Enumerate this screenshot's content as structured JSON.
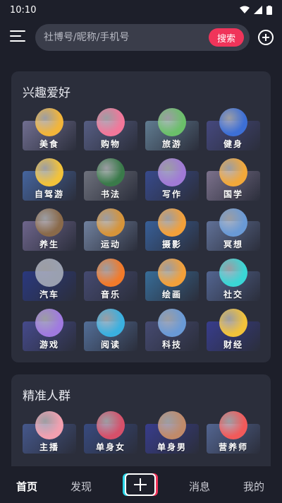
{
  "status": {
    "time": "10:10"
  },
  "search": {
    "placeholder": "社博号/昵称/手机号",
    "button": "搜索"
  },
  "hobbies": {
    "title": "兴趣爱好",
    "items": [
      {
        "label": "美食",
        "icon": "food-icon",
        "color": "#f2b53a",
        "bg": "#7d7aa0"
      },
      {
        "label": "购物",
        "icon": "shopping-bag-icon",
        "color": "#f2779a",
        "bg": "#5e6690"
      },
      {
        "label": "旅游",
        "icon": "travel-icon",
        "color": "#6bbf6a",
        "bg": "#6a8aa0"
      },
      {
        "label": "健身",
        "icon": "fitness-icon",
        "color": "#3d6fd6",
        "bg": "#4a4d8a"
      },
      {
        "label": "自驾游",
        "icon": "car-trip-icon",
        "color": "#f2c23a",
        "bg": "#4a6fb0"
      },
      {
        "label": "书法",
        "icon": "calligraphy-icon",
        "color": "#3a7a4a",
        "bg": "#7a7d88"
      },
      {
        "label": "写作",
        "icon": "writing-icon",
        "color": "#a07ad6",
        "bg": "#3a4f9a"
      },
      {
        "label": "国学",
        "icon": "classics-icon",
        "color": "#f2a83a",
        "bg": "#8a7d9a"
      },
      {
        "label": "养生",
        "icon": "health-icon",
        "color": "#8a6a4a",
        "bg": "#7a6f9a"
      },
      {
        "label": "运动",
        "icon": "sports-icon",
        "color": "#d6943a",
        "bg": "#7d90b0"
      },
      {
        "label": "摄影",
        "icon": "camera-icon",
        "color": "#f2a03a",
        "bg": "#3a68a8"
      },
      {
        "label": "冥想",
        "icon": "meditation-icon",
        "color": "#6a9ad6",
        "bg": "#6a7da8"
      },
      {
        "label": "汽车",
        "icon": "car-icon",
        "color": "#9aa0b0",
        "bg": "#2a3a8a"
      },
      {
        "label": "音乐",
        "icon": "music-icon",
        "color": "#f27a2a",
        "bg": "#4a4f7a"
      },
      {
        "label": "绘画",
        "icon": "palette-icon",
        "color": "#f2a03a",
        "bg": "#3a78a8"
      },
      {
        "label": "社交",
        "icon": "social-icon",
        "color": "#3ad6d6",
        "bg": "#5a6fa0"
      },
      {
        "label": "游戏",
        "icon": "gamepad-icon",
        "color": "#a07ae0",
        "bg": "#4a4f9a"
      },
      {
        "label": "阅读",
        "icon": "reading-icon",
        "color": "#3ab0e0",
        "bg": "#5a7aa8"
      },
      {
        "label": "科技",
        "icon": "tech-icon",
        "color": "#6a9ad6",
        "bg": "#4a4f7a"
      },
      {
        "label": "财经",
        "icon": "finance-icon",
        "color": "#f2c23a",
        "bg": "#3a3f9a"
      }
    ]
  },
  "crowd": {
    "title": "精准人群",
    "items": [
      {
        "label": "主播",
        "icon": "streamer-icon",
        "color": "#f2a0b0",
        "bg": "#4a5f9a"
      },
      {
        "label": "单身女",
        "icon": "single-woman-icon",
        "color": "#d6506a",
        "bg": "#3a4f8a"
      },
      {
        "label": "单身男",
        "icon": "single-man-icon",
        "color": "#c08a6a",
        "bg": "#3a3f9a"
      },
      {
        "label": "营养师",
        "icon": "nutritionist-icon",
        "color": "#f25a5a",
        "bg": "#5a6fa0"
      }
    ]
  },
  "nav": {
    "home": "首页",
    "discover": "发现",
    "messages": "消息",
    "mine": "我的"
  }
}
